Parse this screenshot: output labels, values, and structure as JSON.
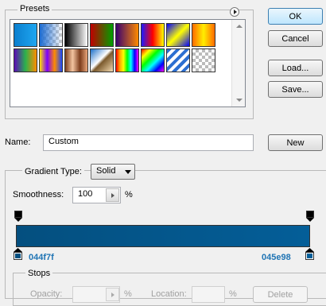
{
  "presets": {
    "label": "Presets",
    "swatches": [
      {
        "name": "foreground-to-background",
        "css": "linear-gradient(90deg,#0b7fcf,#1ea6f0)"
      },
      {
        "name": "foreground-to-transparent",
        "css": "linear-gradient(90deg,#1c6bd1,transparent), repeating-conic-gradient(#ccc 0% 25%, #fff 0% 50%) 0 0/8px 8px"
      },
      {
        "name": "black-white",
        "css": "linear-gradient(90deg,#000,#fff)"
      },
      {
        "name": "red-green",
        "css": "linear-gradient(90deg,#c00000,#00a000)"
      },
      {
        "name": "violet-orange",
        "css": "linear-gradient(90deg,#3a006f,#ff8a00)"
      },
      {
        "name": "blue-red-yellow",
        "css": "linear-gradient(90deg,#1b1bff,#ff0000,#ffff00)"
      },
      {
        "name": "blue-yellow-blue",
        "css": "linear-gradient(135deg,#0000ff,#ffff00,#0000ff)"
      },
      {
        "name": "orange-yellow-orange",
        "css": "linear-gradient(90deg,#ff6a00,#ffee00,#ff6a00)"
      },
      {
        "name": "violet-green-orange",
        "css": "linear-gradient(90deg,#5b0ab7,#2bb24c,#ff8c00)"
      },
      {
        "name": "yellow-violet-orange-blue",
        "css": "linear-gradient(90deg,#ffe100,#7b00ff,#ff8c00,#1747ff)"
      },
      {
        "name": "copper",
        "css": "linear-gradient(90deg,#7c3c1c,#f3c4a0,#7c3c1c,#e9a67b)"
      },
      {
        "name": "chrome",
        "css": "linear-gradient(135deg,#1b6fc9 0%,#ffffff 45%,#7b5a2d 55%,#f3dab0 100%)"
      },
      {
        "name": "spectrum",
        "css": "linear-gradient(90deg,red,orange,yellow,lime,cyan,blue,magenta)"
      },
      {
        "name": "transparent-rainbow",
        "css": "linear-gradient(135deg,#ff0000,#ffff00,#00ff00,#00ffff,#0000ff,#ff00ff)"
      },
      {
        "name": "transparent-stripes",
        "css": "repeating-linear-gradient(135deg,#2c6fd1 0 4px,#fff 4px 8px)"
      },
      {
        "name": "transparent-checker",
        "css": "repeating-conic-gradient(#bbb 0% 25%, #fff 0% 50%) 0 0/8px 8px"
      }
    ]
  },
  "buttons": {
    "ok": "OK",
    "cancel": "Cancel",
    "load": "Load...",
    "save": "Save...",
    "new": "New"
  },
  "name_field": {
    "label": "Name:",
    "value": "Custom"
  },
  "gradient_type": {
    "label": "Gradient Type:",
    "value": "Solid"
  },
  "smoothness": {
    "label": "Smoothness:",
    "value": "100",
    "unit": "%"
  },
  "gradient_bar": {
    "start_color": "#044f7f",
    "end_color": "#045e98"
  },
  "color_stops": {
    "left_label": "044f7f",
    "right_label": "045e98"
  },
  "stops": {
    "label": "Stops",
    "opacity_label": "Opacity:",
    "opacity_unit": "%",
    "location_label": "Location:",
    "location_unit": "%",
    "delete_label": "Delete"
  }
}
